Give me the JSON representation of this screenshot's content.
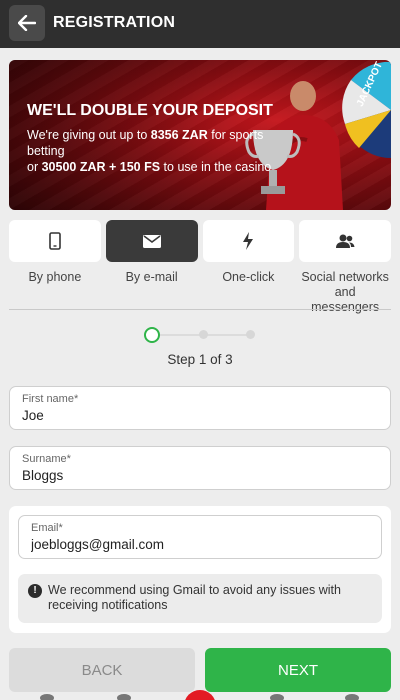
{
  "header": {
    "title": "REGISTRATION",
    "back_icon": "arrow-left-icon"
  },
  "banner": {
    "title": "WE'LL DOUBLE YOUR DEPOSIT",
    "line1_prefix": "We're giving out up to ",
    "line1_amount": "8356 ZAR",
    "line1_suffix": " for sports betting",
    "line2_prefix": "or ",
    "line2_amount": "30500 ZAR + 150 FS",
    "line2_suffix": " to use in the casino",
    "wheel_text": "JACKPOT"
  },
  "methods": [
    {
      "label": "By phone",
      "icon": "phone-icon",
      "active": false
    },
    {
      "label": "By e-mail",
      "icon": "envelope-icon",
      "active": true
    },
    {
      "label": "One-click",
      "icon": "lightning-icon",
      "active": false
    },
    {
      "label": "Social networks and messengers",
      "icon": "people-icon",
      "active": false
    }
  ],
  "stepper": {
    "text": "Step 1 of 3",
    "current": 1,
    "total": 3,
    "accent": "#2fb449"
  },
  "form": {
    "first_name": {
      "label": "First name*",
      "value": "Joe"
    },
    "surname": {
      "label": "Surname*",
      "value": "Bloggs"
    },
    "email": {
      "label": "Email*",
      "value": "joebloggs@gmail.com"
    },
    "notice": "We recommend using Gmail to avoid any issues with receiving notifications",
    "notice_icon": "exclamation-circle-icon"
  },
  "buttons": {
    "back": "BACK",
    "next": "NEXT"
  },
  "colors": {
    "header_bg": "#2f2f2f",
    "accent_green": "#2fb449",
    "brand_red": "#e31b23"
  }
}
